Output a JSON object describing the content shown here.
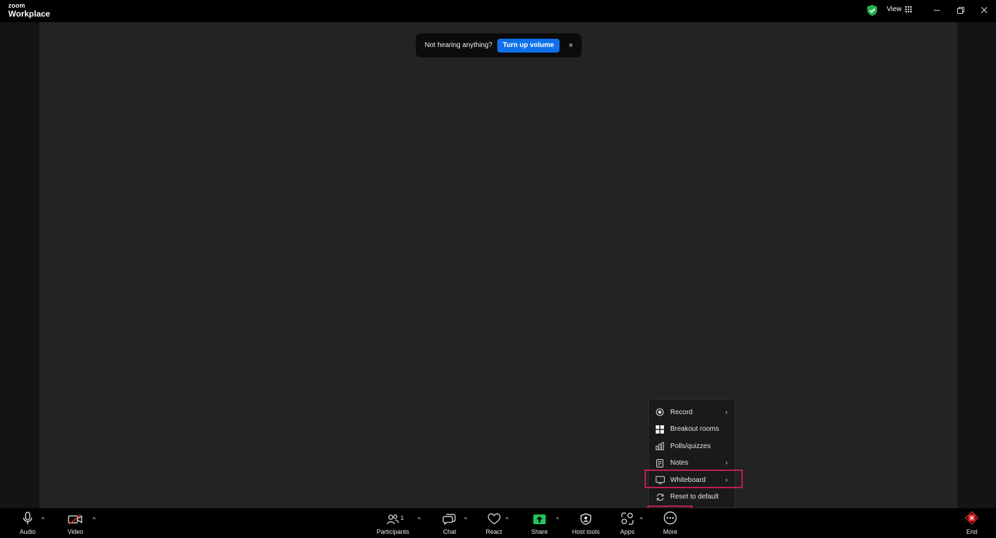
{
  "app": {
    "brand_top": "zoom",
    "brand_main": "Workplace"
  },
  "titlebar": {
    "view_label": "View"
  },
  "notice": {
    "text": "Not hearing anything?",
    "button": "Turn up volume",
    "close": "×"
  },
  "more_menu": {
    "items": [
      {
        "label": "Record",
        "icon": "record-icon",
        "submenu": true
      },
      {
        "label": "Breakout rooms",
        "icon": "breakout-rooms-icon",
        "submenu": false
      },
      {
        "label": "Polls/quizzes",
        "icon": "polls-icon",
        "submenu": false
      },
      {
        "label": "Notes",
        "icon": "notes-icon",
        "submenu": true
      },
      {
        "label": "Whiteboard",
        "icon": "whiteboard-icon",
        "submenu": true
      },
      {
        "label": "Reset to default",
        "icon": "reset-icon",
        "submenu": false
      }
    ],
    "chevron": "›"
  },
  "toolbar": {
    "audio": "Audio",
    "video": "Video",
    "participants": "Participants",
    "participants_count": "1",
    "chat": "Chat",
    "react": "React",
    "share": "Share",
    "host_tools": "Host tools",
    "apps": "Apps",
    "more": "More",
    "end": "End",
    "caret": "^"
  },
  "colors": {
    "accent": "#0e71eb",
    "share_green": "#21c45c",
    "highlight": "#c0204a",
    "end_red": "#e02828",
    "shield_green": "#23b14d"
  }
}
